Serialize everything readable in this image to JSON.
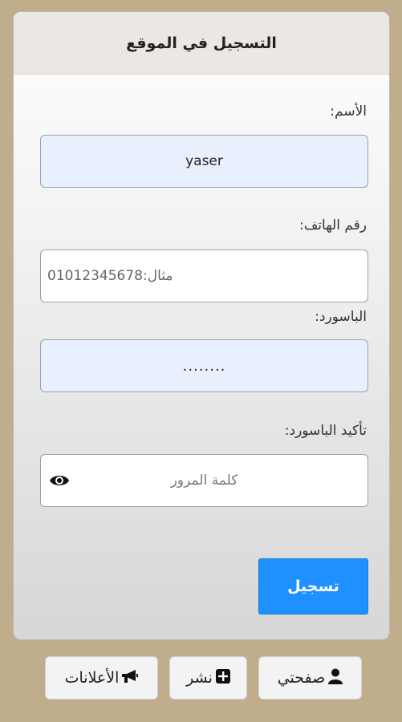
{
  "header": {
    "title": "التسجيل في الموقع"
  },
  "form": {
    "name_label": "الأسم:",
    "name_value": "yaser",
    "phone_label": "رقم الهاتف:",
    "phone_value": "مثال:01012345678",
    "password_label": "الباسورد:",
    "password_value": "........",
    "confirm_label": "تأكيد الباسورد:",
    "confirm_placeholder": "كلمة المرور",
    "submit_label": "تسجيل"
  },
  "bottom_nav": {
    "items": [
      {
        "label": "صفحتي",
        "icon": "user-icon"
      },
      {
        "label": "نشر",
        "icon": "plus-square-icon"
      },
      {
        "label": "الأعلانات",
        "icon": "megaphone-icon"
      }
    ]
  },
  "colors": {
    "page_bg": "#c0ad8c",
    "header_bg": "#ebe7e2",
    "filled_field_bg": "#e8f0fe",
    "submit_bg": "#1e90ff"
  }
}
